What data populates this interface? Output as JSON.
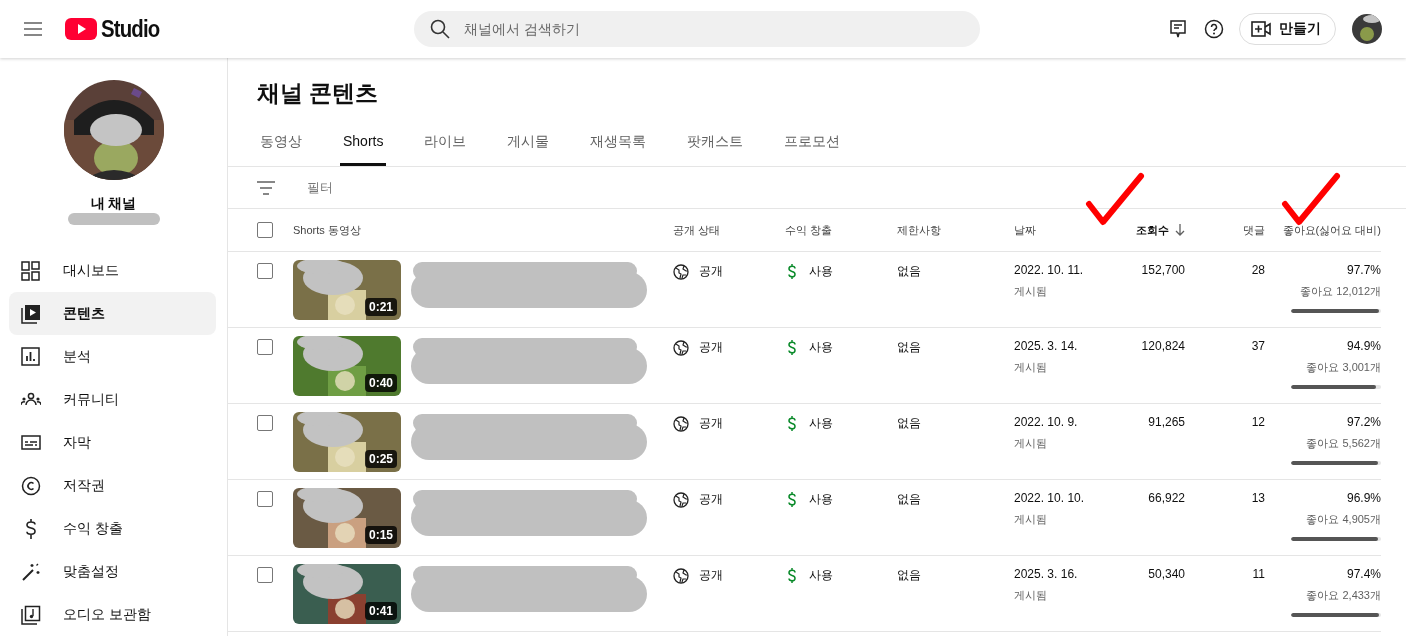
{
  "header": {
    "logo_text": "Studio",
    "search": {
      "placeholder": "채널에서 검색하기"
    },
    "create_button": "만들기"
  },
  "sidebar": {
    "channel_name": "내 채널",
    "items": [
      {
        "kind": "dashboard",
        "label": "대시보드",
        "selected": false
      },
      {
        "kind": "content",
        "label": "콘텐츠",
        "selected": true
      },
      {
        "kind": "analytics",
        "label": "분석",
        "selected": false
      },
      {
        "kind": "community",
        "label": "커뮤니티",
        "selected": false
      },
      {
        "kind": "subtitles",
        "label": "자막",
        "selected": false
      },
      {
        "kind": "copyright",
        "label": "저작권",
        "selected": false
      },
      {
        "kind": "money",
        "label": "수익 창출",
        "selected": false
      },
      {
        "kind": "wand",
        "label": "맞춤설정",
        "selected": false
      },
      {
        "kind": "audio",
        "label": "오디오 보관함",
        "selected": false
      }
    ]
  },
  "page_title": "채널 콘텐츠",
  "tabs": [
    {
      "label": "동영상",
      "selected": false
    },
    {
      "label": "Shorts",
      "selected": true
    },
    {
      "label": "라이브",
      "selected": false
    },
    {
      "label": "게시물",
      "selected": false
    },
    {
      "label": "재생목록",
      "selected": false
    },
    {
      "label": "팟캐스트",
      "selected": false
    },
    {
      "label": "프로모션",
      "selected": false
    }
  ],
  "filter": {
    "placeholder": "필터"
  },
  "table": {
    "select_all_checked": false,
    "columns": [
      {
        "label": "Shorts 동영상",
        "sorted": false,
        "marked": false
      },
      {
        "label": "공개 상태",
        "sorted": false,
        "marked": false
      },
      {
        "label": "수익 창출",
        "sorted": false,
        "marked": false
      },
      {
        "label": "제한사항",
        "sorted": false,
        "marked": false
      },
      {
        "label": "날짜",
        "sorted": false,
        "marked": false
      },
      {
        "label": "조회수",
        "sorted": true,
        "marked": true
      },
      {
        "label": "댓글",
        "sorted": false,
        "marked": false
      },
      {
        "label": "좋아요(싫어요 대비)",
        "sorted": false,
        "marked": true
      }
    ],
    "rows": [
      {
        "checked": false,
        "duration": "0:21",
        "visibility": "공개",
        "monetization": "사용",
        "restrictions": "없음",
        "date": "2022. 10. 11.",
        "date_status": "게시됨",
        "views": "152,700",
        "comments": "28",
        "like_ratio": "97.7%",
        "likes": "좋아요 12,012개",
        "level": 0.977
      },
      {
        "checked": false,
        "duration": "0:40",
        "visibility": "공개",
        "monetization": "사용",
        "restrictions": "없음",
        "date": "2025. 3. 14.",
        "date_status": "게시됨",
        "views": "120,824",
        "comments": "37",
        "like_ratio": "94.9%",
        "likes": "좋아요 3,001개",
        "level": 0.949
      },
      {
        "checked": false,
        "duration": "0:25",
        "visibility": "공개",
        "monetization": "사용",
        "restrictions": "없음",
        "date": "2022. 10. 9.",
        "date_status": "게시됨",
        "views": "91,265",
        "comments": "12",
        "like_ratio": "97.2%",
        "likes": "좋아요 5,562개",
        "level": 0.972
      },
      {
        "checked": false,
        "duration": "0:15",
        "visibility": "공개",
        "monetization": "사용",
        "restrictions": "없음",
        "date": "2022. 10. 10.",
        "date_status": "게시됨",
        "views": "66,922",
        "comments": "13",
        "like_ratio": "96.9%",
        "likes": "좋아요 4,905개",
        "level": 0.969
      },
      {
        "checked": false,
        "duration": "0:41",
        "visibility": "공개",
        "monetization": "사용",
        "restrictions": "없음",
        "date": "2025. 3. 16.",
        "date_status": "게시됨",
        "views": "50,340",
        "comments": "11",
        "like_ratio": "97.4%",
        "likes": "좋아요 2,433개",
        "level": 0.974
      }
    ]
  }
}
